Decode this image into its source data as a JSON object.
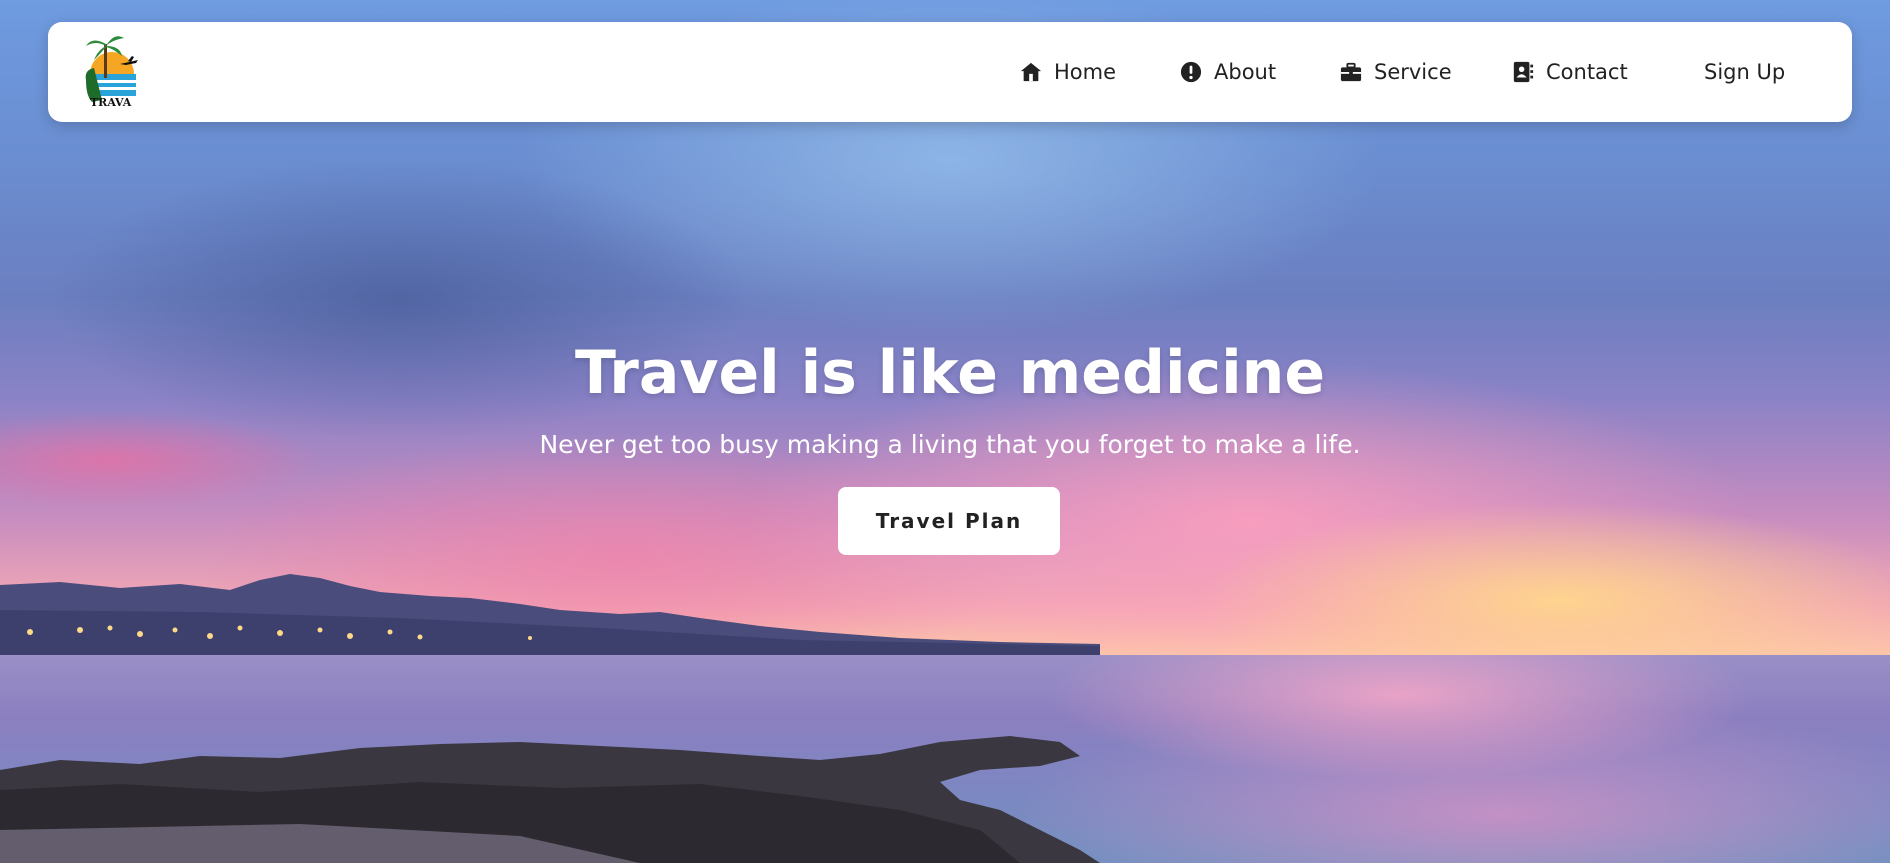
{
  "brand": {
    "logo_text": "TRAVA",
    "logo_icon": "palm-tree-airplane-logo-icon"
  },
  "nav": {
    "items": [
      {
        "label": "Home",
        "icon": "house-icon"
      },
      {
        "label": "About",
        "icon": "exclamation-circle-icon"
      },
      {
        "label": "Service",
        "icon": "briefcase-icon"
      },
      {
        "label": "Contact",
        "icon": "address-book-icon"
      }
    ],
    "signup_label": "Sign Up"
  },
  "hero": {
    "title": "Travel is like medicine",
    "subtitle": "Never get too busy making a living that you forget to make a life.",
    "cta_label": "Travel Plan"
  },
  "colors": {
    "navbar_bg": "#ffffff",
    "nav_text": "#222222",
    "hero_text": "#ffffff",
    "button_bg": "#ffffff",
    "button_text": "#222222"
  }
}
